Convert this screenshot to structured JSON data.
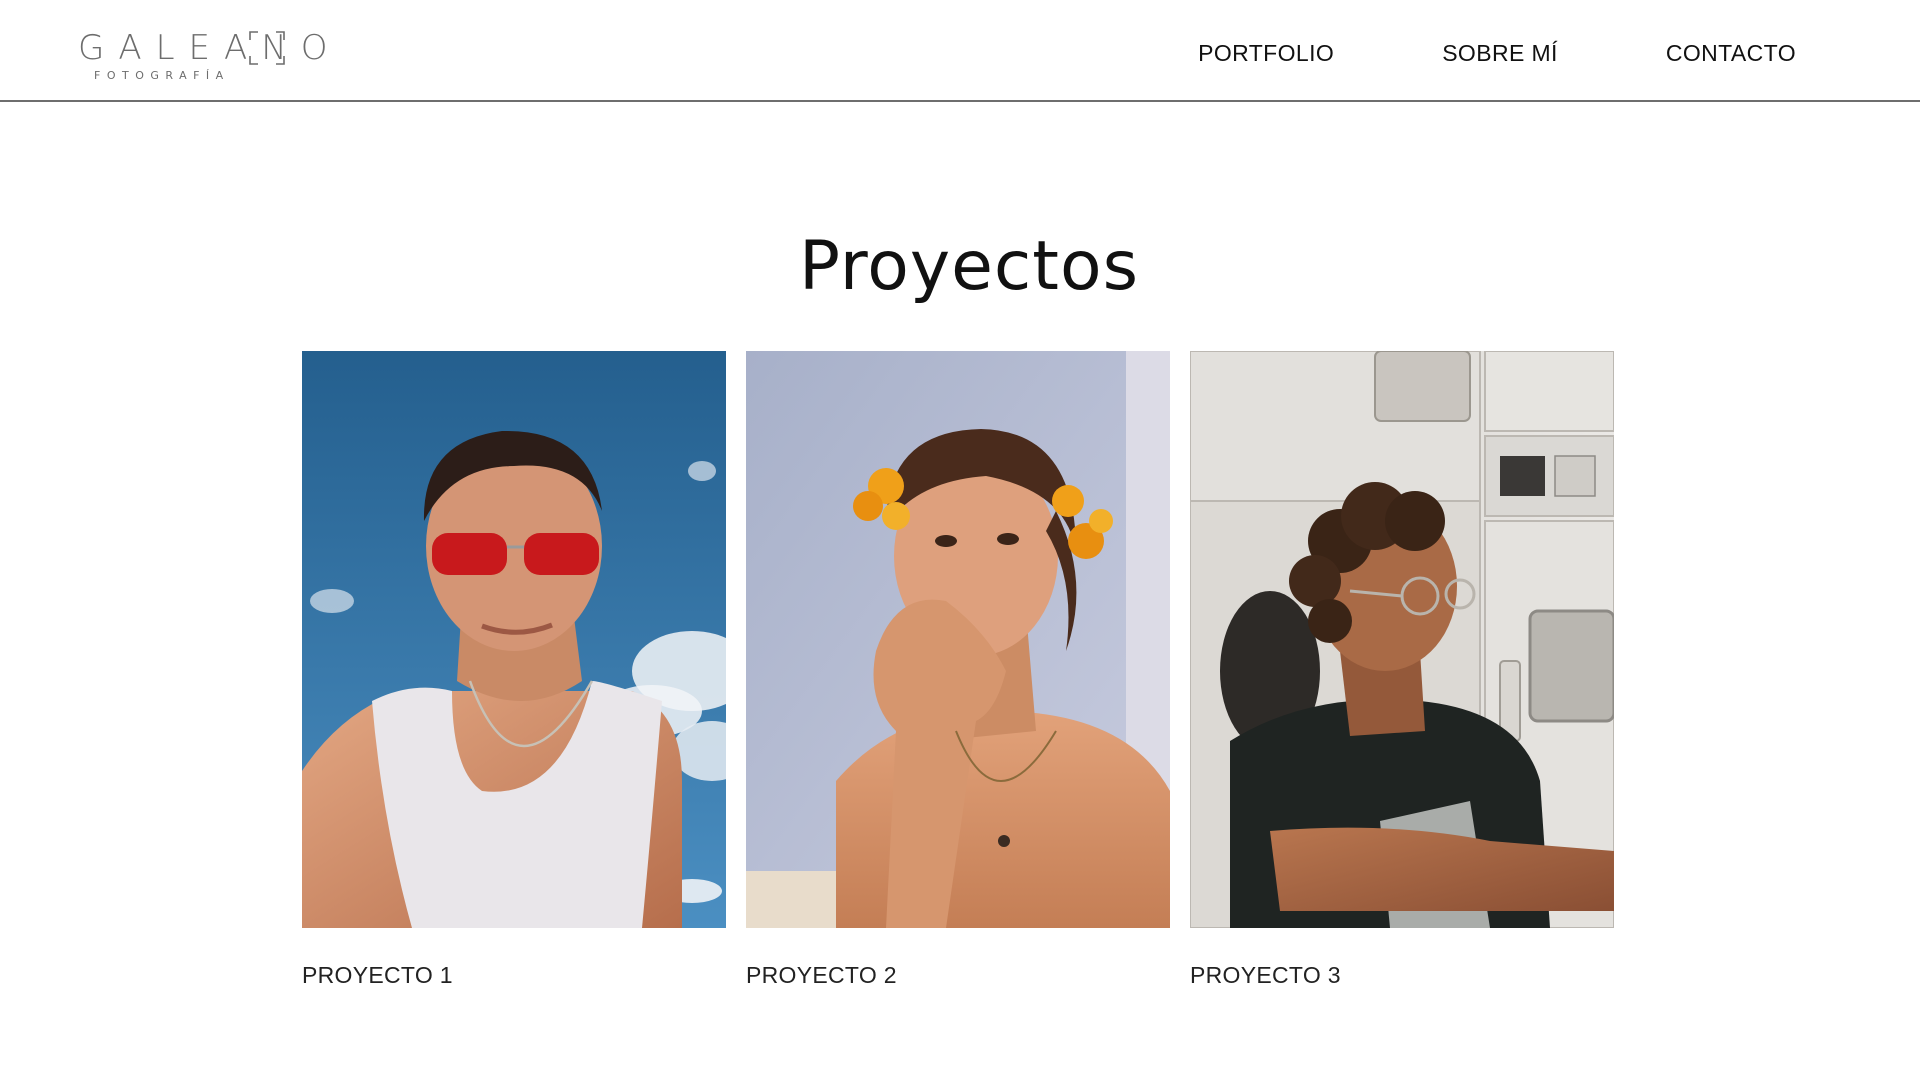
{
  "brand": {
    "name": "GALEANO",
    "tagline": "FOTOGRAFÍA"
  },
  "nav": {
    "items": [
      {
        "label": "PORTFOLIO"
      },
      {
        "label": "SOBRE MÍ"
      },
      {
        "label": "CONTACTO"
      }
    ]
  },
  "main": {
    "title": "Proyectos",
    "projects": [
      {
        "caption": "PROYECTO 1",
        "image": "portrait-man-red-sunglasses-sky"
      },
      {
        "caption": "PROYECTO 2",
        "image": "portrait-man-orange-flowers"
      },
      {
        "caption": "PROYECTO 3",
        "image": "portrait-man-glasses-laundromat"
      }
    ]
  },
  "colors": {
    "text": "#111111",
    "logo": "#6d6d6d",
    "divider": "#6e6e6e",
    "background": "#ffffff"
  }
}
